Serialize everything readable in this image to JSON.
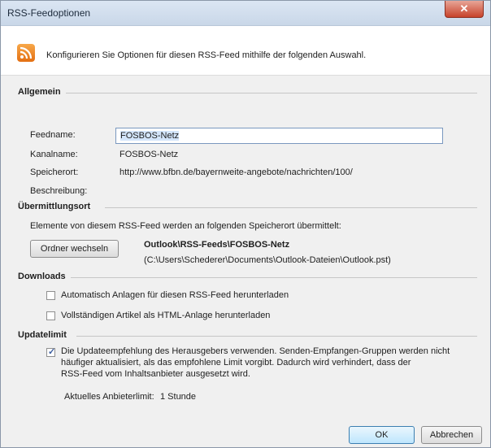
{
  "window": {
    "title": "RSS-Feedoptionen",
    "close_label": "✕"
  },
  "header": {
    "description": "Konfigurieren Sie Optionen für diesen RSS-Feed mithilfe der folgenden Auswahl."
  },
  "general": {
    "heading": "Allgemein",
    "feedname_label": "Feedname:",
    "feedname_value": "FOSBOS-Netz",
    "channel_label": "Kanalname:",
    "channel_value": "FOSBOS-Netz",
    "location_label": "Speicherort:",
    "location_value": "http://www.bfbn.de/bayernweite-angebote/nachrichten/100/",
    "description_label": "Beschreibung:"
  },
  "delivery": {
    "heading": "Übermittlungsort",
    "info": "Elemente von diesem RSS-Feed werden an folgenden Speicherort übermittelt:",
    "change_folder_button": "Ordner wechseln",
    "folder_path": "Outlook\\RSS-Feeds\\FOSBOS-Netz",
    "file_path": "(C:\\Users\\Schederer\\Documents\\Outlook-Dateien\\Outlook.pst)"
  },
  "downloads": {
    "heading": "Downloads",
    "option1": "Automatisch Anlagen für diesen RSS-Feed herunterladen",
    "option1_checked": false,
    "option2": "Vollständigen Artikel als HTML-Anlage herunterladen",
    "option2_checked": false
  },
  "update": {
    "heading": "Updatelimit",
    "option_text_line1": "Die Updateempfehlung des Herausgebers verwenden. Senden-Empfangen-Gruppen werden nicht",
    "option_text_line2": "häufiger aktualisiert, als das empfohlene Limit vorgibt. Dadurch wird verhindert, dass der",
    "option_text_line3": "RSS-Feed vom Inhaltsanbieter ausgesetzt wird.",
    "option_checked": true,
    "current_limit_label": "Aktuelles Anbieterlimit:",
    "current_limit_value": "1 Stunde"
  },
  "footer": {
    "ok_button": "OK",
    "cancel_button": "Abbrechen"
  },
  "colors": {
    "titlebar": "#c9d7e8",
    "close_button": "#c7432b",
    "rss_icon": "#e46f12",
    "panel": "#f0f0f0",
    "selection": "#d3e5fa"
  }
}
